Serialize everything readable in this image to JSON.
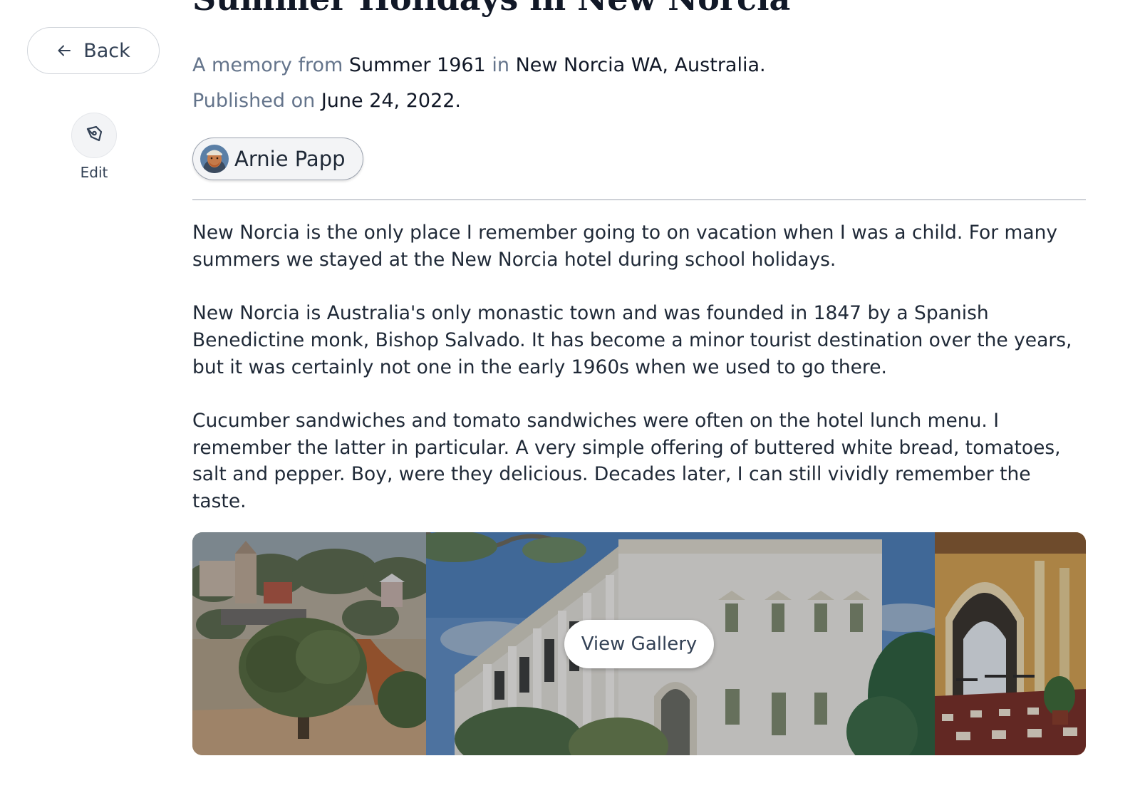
{
  "nav": {
    "back_label": "Back",
    "edit_label": "Edit"
  },
  "memory": {
    "title": "Summer Holidays in New Norcia",
    "meta_prefix": "A memory from",
    "season": "Summer 1961",
    "meta_in": "in",
    "location": "New Norcia WA, Australia.",
    "published_prefix": "Published on",
    "published_date": "June 24, 2022."
  },
  "author": {
    "name": "Arnie Papp"
  },
  "body": {
    "paragraphs": [
      "New Norcia is the only place I remember going to on vacation when I was a child. For many summers we stayed at the New Norcia hotel during school holidays.",
      "New Norcia is Australia's only monastic town and was founded in 1847 by a Spanish Benedictine monk, Bishop Salvado. It has become a minor tourist destination over the years, but it was certainly not one in the early 1960s when we used to go there.",
      "Cucumber sandwiches and tomato sandwiches were often on the hotel lunch menu. I remember the latter in particular. A very simple offering of buttered white bread, tomatoes, salt and pepper. Boy, were they delicious. Decades later, I can still vividly remember the taste."
    ]
  },
  "gallery": {
    "button_label": "View Gallery",
    "photos": [
      "landscape-photo",
      "hotel-photo",
      "veranda-photo"
    ]
  },
  "colors": {
    "text": "#1f2937",
    "muted": "#64748b",
    "border": "#d1d5db"
  }
}
